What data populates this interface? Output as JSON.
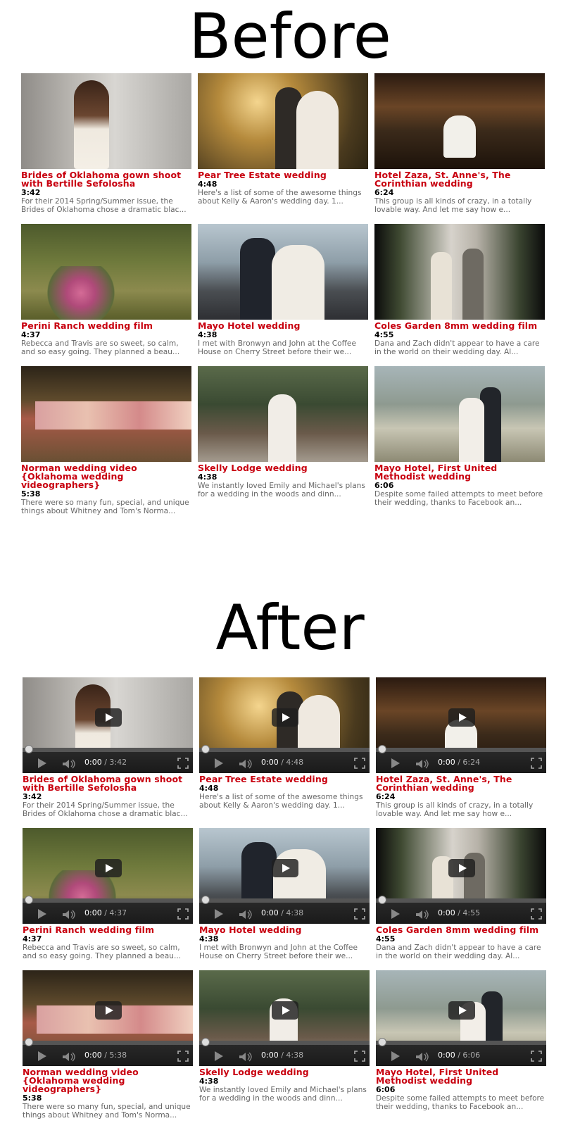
{
  "sections": {
    "before_title": "Before",
    "after_title": "After"
  },
  "player": {
    "current_time": "0:00",
    "separator": " / ",
    "icons": [
      "play-icon",
      "volume-icon",
      "fullscreen-icon",
      "big-play-icon"
    ]
  },
  "videos": [
    {
      "title": "Brides of Oklahoma gown shoot with Bertille Sefolosha",
      "duration": "3:42",
      "description": "For their 2014 Spring/Summer issue, the Brides of Oklahoma chose a dramatic blac...",
      "description_after": "For their 2014 Spring/Summer issue, the Brides of Oklahoma chose a dramatic blac..."
    },
    {
      "title": "Pear Tree Estate wedding",
      "duration": "4:48",
      "description": "Here's a list of some of the awesome things about Kelly & Aaron's wedding day. 1...",
      "description_after": "Here's a list of some of the awesome things about Kelly & Aaron's wedding day. 1..."
    },
    {
      "title": "Hotel Zaza, St. Anne's, The Corinthian wedding",
      "duration": "6:24",
      "description": "This group is all kinds of crazy, in a totally lovable way. And let me say how e...",
      "description_after": "This group is all kinds of crazy, in a totally lovable way. And let me say how e..."
    },
    {
      "title": "Perini Ranch wedding film",
      "duration": "4:37",
      "description": "Rebecca and Travis are so sweet, so calm, and so easy going. They planned a beau...",
      "description_after": "Rebecca and Travis are so sweet, so calm, and so easy going. They planned a beau..."
    },
    {
      "title": "Mayo Hotel wedding",
      "duration": "4:38",
      "description": "I met with Bronwyn and John at the Coffee House on Cherry Street before their we...",
      "description_after": "I met with Bronwyn and John at the Coffee House on Cherry Street before their we..."
    },
    {
      "title": "Coles Garden 8mm wedding film",
      "duration": "4:55",
      "description": "Dana and Zach didn't appear to have a care in the world on their wedding day. Al...",
      "description_after": "Dana and Zach didn't appear to have a care in the world on their wedding day. Al..."
    },
    {
      "title": "Norman wedding video {Oklahoma wedding videographers}",
      "duration": "5:38",
      "description": "There were so many fun, special, and unique things about Whitney and Tom's Norma...",
      "description_after": "There were so many fun, special, and unique things about Whitney and Tom's Norma..."
    },
    {
      "title": "Skelly Lodge wedding",
      "duration": "4:38",
      "description": "We instantly loved Emily and Michael's plans for a wedding in the woods and dinn...",
      "description_after": "We instantly loved Emily and Michael's plans for a wedding in the woods and dinn..."
    },
    {
      "title": "Mayo Hotel, First United Methodist wedding",
      "duration": "6:06",
      "description": "Despite some failed attempts to meet before their wedding, thanks to Facebook an...",
      "description_after": "Despite some failed attempts to meet before their wedding, thanks to Facebook an..."
    }
  ]
}
